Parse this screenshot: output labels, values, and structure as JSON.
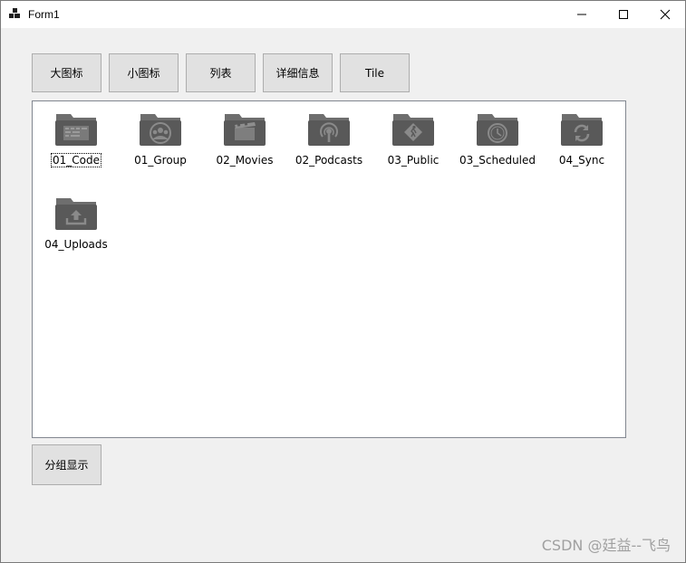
{
  "window": {
    "title": "Form1"
  },
  "toolbar": {
    "buttons": [
      {
        "label": "大图标"
      },
      {
        "label": "小图标"
      },
      {
        "label": "列表"
      },
      {
        "label": "详细信息"
      },
      {
        "label": "Tile"
      }
    ]
  },
  "listview": {
    "items": [
      {
        "name": "01_Code",
        "icon": "code-folder-icon",
        "focused": true
      },
      {
        "name": "01_Group",
        "icon": "group-folder-icon"
      },
      {
        "name": "02_Movies",
        "icon": "movies-folder-icon"
      },
      {
        "name": "02_Podcasts",
        "icon": "podcasts-folder-icon"
      },
      {
        "name": "03_Public",
        "icon": "public-folder-icon"
      },
      {
        "name": "03_Scheduled",
        "icon": "scheduled-folder-icon"
      },
      {
        "name": "04_Sync",
        "icon": "sync-folder-icon"
      },
      {
        "name": "04_Uploads",
        "icon": "uploads-folder-icon"
      }
    ]
  },
  "group_button": {
    "label": "分组显示"
  },
  "watermark": "CSDN @廷益--飞鸟",
  "colors": {
    "folder": "#5a5a5a",
    "folder_tab": "#6e6e6e",
    "button_bg": "#e1e1e1",
    "window_bg": "#f0f0f0"
  }
}
